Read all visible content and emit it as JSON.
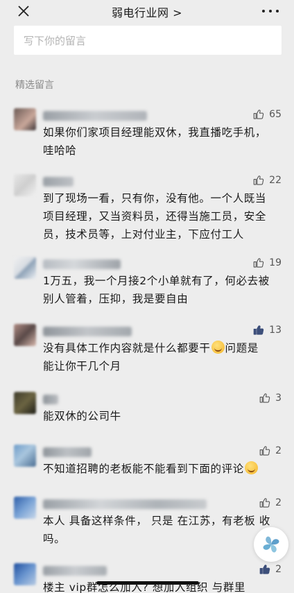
{
  "header": {
    "title": "弱电行业网 >"
  },
  "input": {
    "placeholder": "写下你的留言"
  },
  "section": {
    "title": "精选留言"
  },
  "comments": [
    {
      "likes": "65",
      "liked": false,
      "text": [
        "如果你们家项目经理能双休，我直播吃手机，",
        "哇哈哈"
      ]
    },
    {
      "likes": "22",
      "liked": false,
      "text": [
        "到了现场一看，只有你，没有他。一个人既当",
        "项目经理，又当资料员，还得当施工员，安全",
        "员，技术员等，上对付业主，下应付工人"
      ]
    },
    {
      "likes": "19",
      "liked": false,
      "text": [
        "1万五，我一个月接2个小单就有了，何必去被",
        "别人管着，压抑，我是要自由"
      ]
    },
    {
      "likes": "13",
      "liked": true,
      "text_a": "没有具体工作内容就是什么都要干",
      "text_b": "问题是",
      "text_c": "能让你干几个月"
    },
    {
      "likes": "3",
      "liked": false,
      "text": [
        "能双休的公司牛"
      ]
    },
    {
      "likes": "2",
      "liked": false,
      "text_a": "不知道招聘的老板能不能看到下面的评论"
    },
    {
      "likes": "2",
      "liked": false,
      "text": [
        "本人 具备这样条件， 只是 在江苏，有老板 收",
        "吗。"
      ]
    },
    {
      "likes": "2",
      "liked": true,
      "text": [
        "楼主   vip群怎么加入? 想加入组织   与群里"
      ]
    }
  ],
  "colors": {
    "background": "#ededed",
    "like_active": "#3d4f7a",
    "like_inactive": "#555555"
  },
  "icons": {
    "close": "close-icon",
    "more": "more-icon",
    "like": "thumbs-up-icon",
    "fab": "leaf-logo-icon"
  }
}
